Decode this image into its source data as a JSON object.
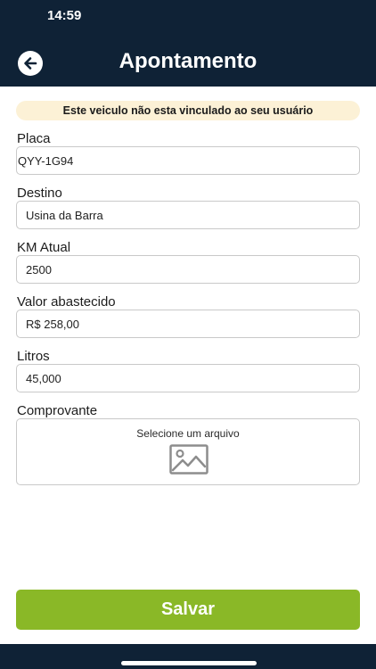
{
  "status_bar": {
    "time": "14:59"
  },
  "header": {
    "title": "Apontamento",
    "back_icon": "arrow-left-circle-icon"
  },
  "warning": {
    "text": "Este veiculo não esta vinculado ao seu usuário"
  },
  "form": {
    "placa": {
      "label": "Placa",
      "value": "QYY-1G94"
    },
    "destino": {
      "label": "Destino",
      "value": "Usina da Barra"
    },
    "km_atual": {
      "label": "KM Atual",
      "value": "2500"
    },
    "valor_abastecido": {
      "label": "Valor abastecido",
      "value": "R$ 258,00"
    },
    "litros": {
      "label": "Litros",
      "value": "45,000"
    },
    "comprovante": {
      "label": "Comprovante",
      "placeholder": "Selecione um arquivo",
      "icon": "image-icon"
    }
  },
  "actions": {
    "save_label": "Salvar"
  },
  "colors": {
    "header_bg": "#0f2236",
    "accent": "#8ab827",
    "warning_bg": "#fcf1d6"
  }
}
